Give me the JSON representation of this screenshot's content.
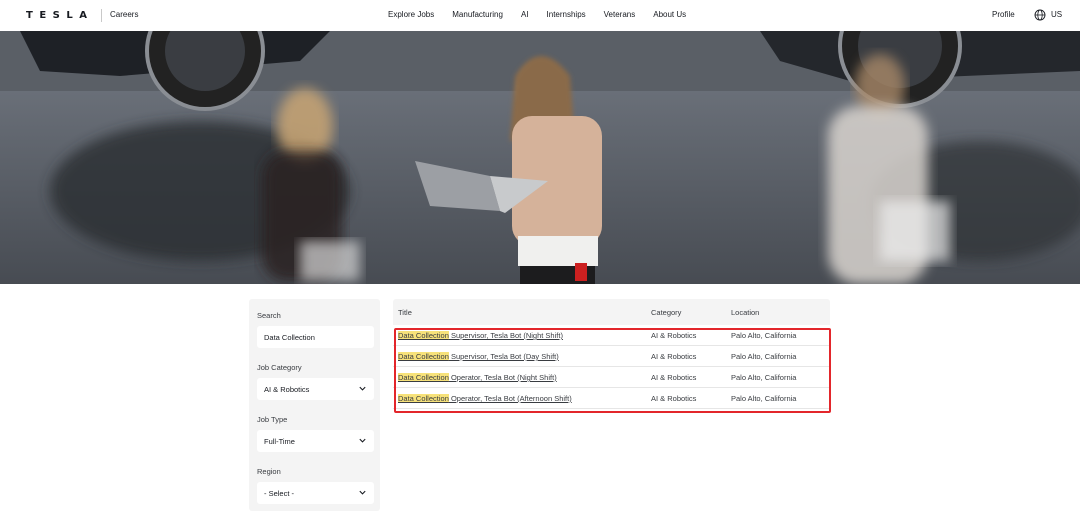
{
  "header": {
    "logo": "TESLA",
    "section": "Careers",
    "nav": [
      "Explore Jobs",
      "Manufacturing",
      "AI",
      "Internships",
      "Veterans",
      "About Us"
    ],
    "profile": "Profile",
    "region": "US"
  },
  "filters": {
    "search_label": "Search",
    "search_value": "Data Collection",
    "category_label": "Job Category",
    "category_value": "AI & Robotics",
    "type_label": "Job Type",
    "type_value": "Full-Time",
    "region_label": "Region",
    "region_value": "- Select -"
  },
  "results": {
    "columns": [
      "Title",
      "Category",
      "Location"
    ],
    "rows": [
      {
        "highlight": "Data Collection",
        "title_rest": " Supervisor, Tesla Bot (Night Shift)",
        "category": "AI & Robotics",
        "location": "Palo Alto, California"
      },
      {
        "highlight": "Data Collection",
        "title_rest": " Supervisor, Tesla Bot (Day Shift)",
        "category": "AI & Robotics",
        "location": "Palo Alto, California"
      },
      {
        "highlight": "Data Collection",
        "title_rest": " Operator, Tesla Bot (Night Shift)",
        "category": "AI & Robotics",
        "location": "Palo Alto, California"
      },
      {
        "highlight": "Data Collection",
        "title_rest": " Operator, Tesla Bot (Afternoon Shift)",
        "category": "AI & Robotics",
        "location": "Palo Alto, California"
      }
    ]
  },
  "colors": {
    "highlight": "#f7e27a",
    "annotation_border": "#e3262b",
    "panel_bg": "#f4f4f4"
  },
  "icons": [
    "globe-icon",
    "chevron-down-icon"
  ]
}
